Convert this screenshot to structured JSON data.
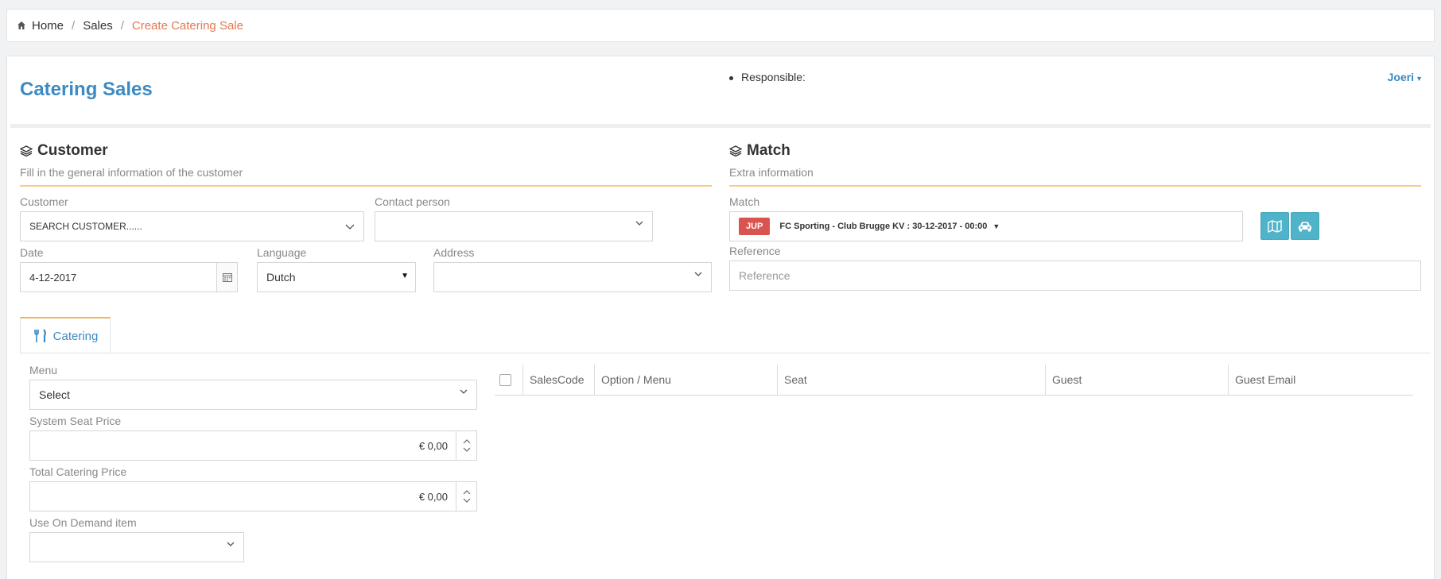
{
  "breadcrumb": {
    "home": "Home",
    "sales": "Sales",
    "current": "Create Catering Sale"
  },
  "header": {
    "title": "Catering Sales",
    "responsible_label": "Responsible:",
    "user": "Joeri"
  },
  "customer_section": {
    "title": "Customer",
    "subtitle": "Fill in the general information of the customer",
    "customer_label": "Customer",
    "customer_value": "SEARCH CUSTOMER......",
    "contact_label": "Contact person",
    "contact_value": "",
    "date_label": "Date",
    "date_value": "4-12-2017",
    "language_label": "Language",
    "language_value": "Dutch",
    "address_label": "Address",
    "address_value": ""
  },
  "match_section": {
    "title": "Match",
    "subtitle": "Extra information",
    "match_label": "Match",
    "match_badge": "JUP",
    "match_value": "FC Sporting - Club Brugge KV : 30-12-2017 - 00:00",
    "reference_label": "Reference",
    "reference_placeholder": "Reference"
  },
  "tabs": {
    "catering": "Catering"
  },
  "catering_form": {
    "menu_label": "Menu",
    "menu_value": "Select",
    "system_seat_price_label": "System Seat Price",
    "system_seat_price_value": "€ 0,00",
    "total_catering_price_label": "Total Catering Price",
    "total_catering_price_value": "€ 0,00",
    "on_demand_label": "Use On Demand item",
    "on_demand_value": ""
  },
  "table": {
    "columns": [
      "SalesCode",
      "Option / Menu",
      "Seat",
      "Guest",
      "Guest Email"
    ]
  },
  "colors": {
    "accent_blue": "#3d8ac3",
    "breadcrumb_active": "#e6784e",
    "badge_red": "#d9534f",
    "button_teal": "#4fb3c9",
    "section_underline": "#f8c98a"
  }
}
